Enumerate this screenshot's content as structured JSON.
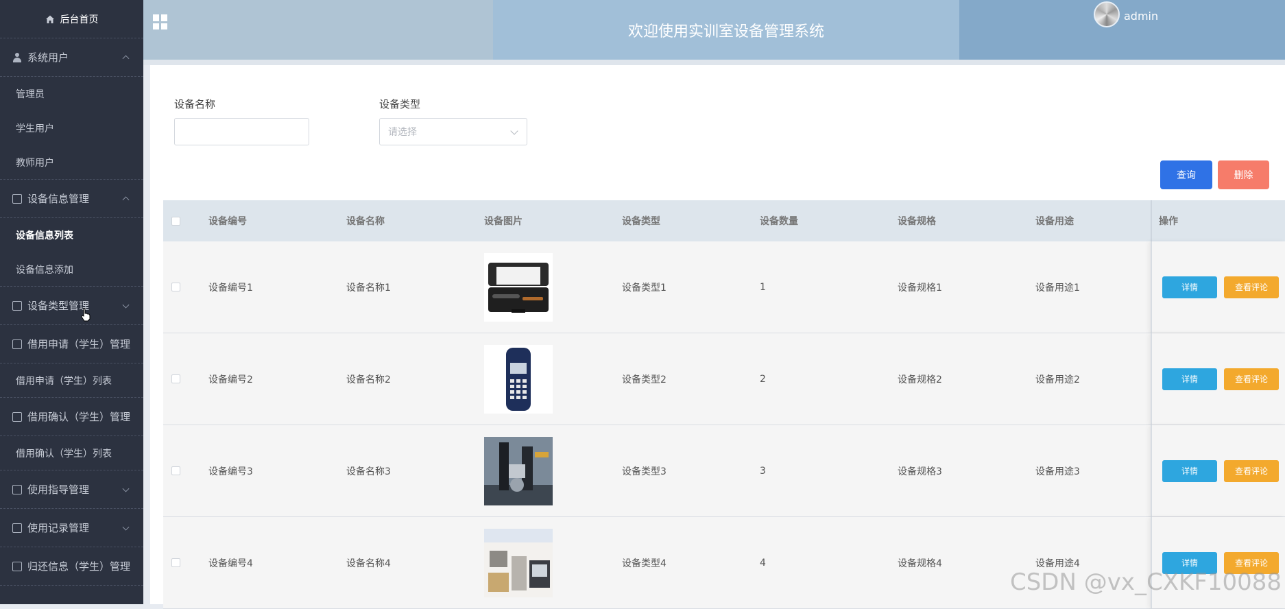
{
  "sidebar": {
    "home": "后台首页",
    "groups": [
      {
        "label": "系统用户",
        "items": [
          "管理员",
          "学生用户",
          "教师用户"
        ]
      },
      {
        "label": "设备信息管理",
        "items": [
          "设备信息列表",
          "设备信息添加"
        ]
      },
      {
        "label": "设备类型管理",
        "items": []
      },
      {
        "label": "借用申请（学生）管理",
        "items": [
          "借用申请（学生）列表"
        ]
      },
      {
        "label": "借用确认（学生）管理",
        "items": [
          "借用确认（学生）列表"
        ]
      },
      {
        "label": "使用指导管理",
        "items": []
      },
      {
        "label": "使用记录管理",
        "items": []
      },
      {
        "label": "归还信息（学生）管理",
        "items": []
      }
    ]
  },
  "header": {
    "title": "欢迎使用实训室设备管理系统",
    "username": "admin"
  },
  "filters": {
    "name_label": "设备名称",
    "name_value": "",
    "type_label": "设备类型",
    "type_placeholder": "请选择"
  },
  "actions": {
    "query": "查询",
    "delete": "删除"
  },
  "table": {
    "columns": [
      "设备编号",
      "设备名称",
      "设备图片",
      "设备类型",
      "设备数量",
      "设备规格",
      "设备用途",
      "操作"
    ],
    "rows": [
      {
        "code": "设备编号1",
        "name": "设备名称1",
        "type": "设备类型1",
        "qty": "1",
        "spec": "设备规格1",
        "usage": "设备用途1"
      },
      {
        "code": "设备编号2",
        "name": "设备名称2",
        "type": "设备类型2",
        "qty": "2",
        "spec": "设备规格2",
        "usage": "设备用途2"
      },
      {
        "code": "设备编号3",
        "name": "设备名称3",
        "type": "设备类型3",
        "qty": "3",
        "spec": "设备规格3",
        "usage": "设备用途3"
      },
      {
        "code": "设备编号4",
        "name": "设备名称4",
        "type": "设备类型4",
        "qty": "4",
        "spec": "设备规格4",
        "usage": "设备用途4"
      }
    ],
    "row_buttons": {
      "detail": "详情",
      "review": "查看评论"
    }
  },
  "watermark": "CSDN @vx_CXKF10088",
  "colors": {
    "sidebar": "#2c3240",
    "query": "#2f72e6",
    "delete": "#f67c6a",
    "detail": "#2ea6df",
    "review": "#f3a92d"
  }
}
